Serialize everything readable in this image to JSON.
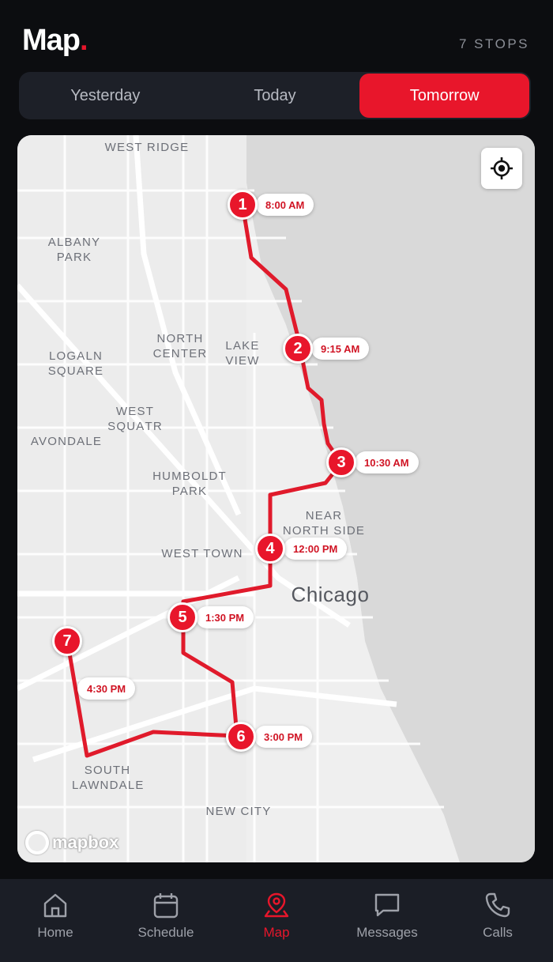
{
  "header": {
    "title": "Map",
    "title_dot": ".",
    "stops_count": "7 STOPS"
  },
  "segments": [
    {
      "label": "Yesterday",
      "active": false
    },
    {
      "label": "Today",
      "active": false
    },
    {
      "label": "Tomorrow",
      "active": true
    }
  ],
  "map": {
    "areas": [
      {
        "name": "WEST RIDGE"
      },
      {
        "name": "ALBANY PARK"
      },
      {
        "name": "NORTH CENTER"
      },
      {
        "name": "LAKE VIEW"
      },
      {
        "name": "LOGALN SQUARE"
      },
      {
        "name": "WEST SQUAТR"
      },
      {
        "name": "AVONDALE"
      },
      {
        "name": "HUMBOLDT PARK"
      },
      {
        "name": "NEAR NORTH SIDE"
      },
      {
        "name": "WEST TOWN"
      },
      {
        "name": "SOUTH LAWNDALE"
      },
      {
        "name": "NEW CITY"
      }
    ],
    "city": "Chicago",
    "attribution": "mapbox",
    "locate_icon": "crosshair-icon",
    "stops": [
      {
        "number": "1",
        "time": "8:00 AM"
      },
      {
        "number": "2",
        "time": "9:15 AM"
      },
      {
        "number": "3",
        "time": "10:30 AM"
      },
      {
        "number": "4",
        "time": "12:00 PM"
      },
      {
        "number": "5",
        "time": "1:30 PM"
      },
      {
        "number": "6",
        "time": "3:00 PM"
      },
      {
        "number": "7",
        "time": "4:30 PM"
      }
    ]
  },
  "tabs": [
    {
      "label": "Home",
      "icon": "home-icon",
      "active": false
    },
    {
      "label": "Schedule",
      "icon": "calendar-icon",
      "active": false
    },
    {
      "label": "Map",
      "icon": "map-pin-icon",
      "active": true
    },
    {
      "label": "Messages",
      "icon": "chat-icon",
      "active": false
    },
    {
      "label": "Calls",
      "icon": "phone-icon",
      "active": false
    }
  ],
  "colors": {
    "accent": "#e8162b",
    "background": "#0c0d10",
    "tabbar": "#1b1e26"
  }
}
